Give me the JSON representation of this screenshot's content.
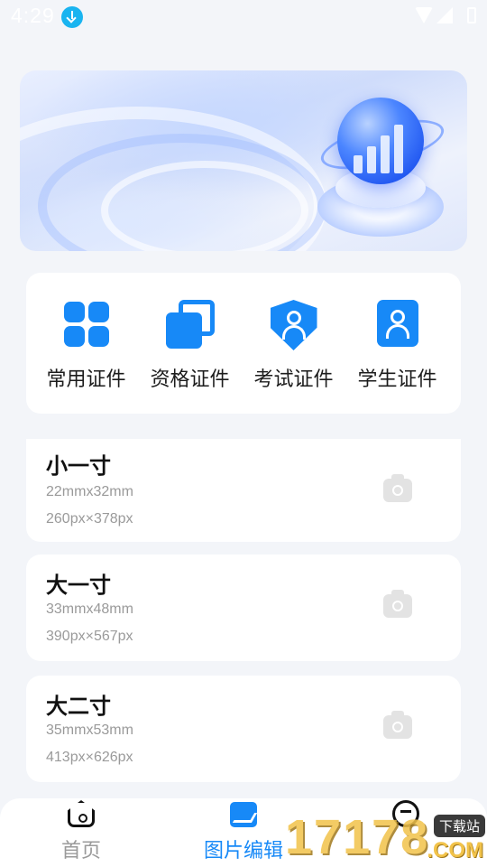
{
  "status_bar": {
    "time": "4:29"
  },
  "categories": [
    {
      "label": "常用证件",
      "icon": "grid-icon"
    },
    {
      "label": "资格证件",
      "icon": "copy-icon"
    },
    {
      "label": "考试证件",
      "icon": "shield-person-icon"
    },
    {
      "label": "学生证件",
      "icon": "badge-person-icon"
    }
  ],
  "sizes": [
    {
      "name": "小一寸",
      "mm": "22mmx32mm",
      "px": "260px×378px"
    },
    {
      "name": "大一寸",
      "mm": "33mmx48mm",
      "px": "390px×567px"
    },
    {
      "name": "大二寸",
      "mm": "35mmx53mm",
      "px": "413px×626px"
    }
  ],
  "bottom_nav": [
    {
      "label": "首页",
      "icon": "home-icon",
      "active": false
    },
    {
      "label": "图片编辑",
      "icon": "image-edit-icon",
      "active": true
    },
    {
      "label": "",
      "icon": "face-icon",
      "active": false
    }
  ],
  "watermark": {
    "number": "17178",
    "tag": "下载站",
    "domain": ".COM"
  },
  "colors": {
    "accent": "#1789f7",
    "background": "#f3f5f9",
    "active_nav": "#1789f7",
    "inactive_nav": "#9a9a9a",
    "sub_text": "#9a9a9a"
  }
}
